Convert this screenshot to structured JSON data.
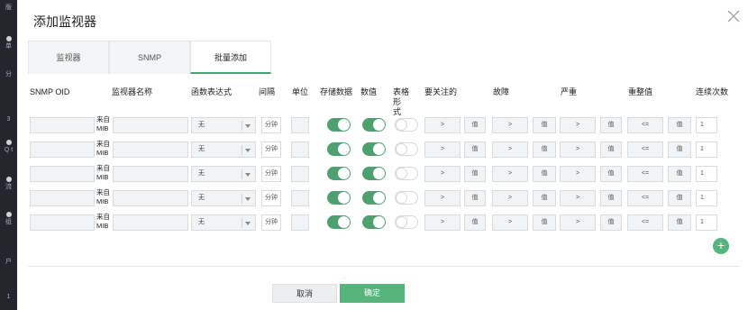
{
  "sidebar": {
    "fragments": [
      "版",
      "单",
      "分",
      "3",
      "Q\nt",
      "流",
      "组",
      "户",
      "1"
    ]
  },
  "dialog": {
    "title": "添加监视器",
    "tabs": [
      "监视器",
      "SNMP",
      "批量添加"
    ],
    "active_tab": "批量添加",
    "columns": {
      "snmp_oid": "SNMP OID",
      "monitor_name": "监视器名称",
      "function_expr": "函数表达式",
      "interval": "间隔",
      "unit": "单位",
      "store_data": "存储数据",
      "numeric": "数值",
      "table_format": "表格形\n式",
      "attention": "要关注的",
      "fault": "故障",
      "severe": "严重",
      "clear_value": "重整值",
      "consecutive": "连续次数"
    },
    "rows": [
      {
        "mib_label": "来自\nMIB",
        "function": "无",
        "interval_placeholder": "分钟",
        "store": true,
        "numeric": true,
        "table": false,
        "att_op": ">",
        "att_val": "值",
        "fault_op": ">",
        "fault_val": "值",
        "severe_op": ">",
        "severe_val": "值",
        "clear_op": "<=",
        "clear_val": "值",
        "count": "1"
      },
      {
        "mib_label": "来自\nMIB",
        "function": "无",
        "interval_placeholder": "分钟",
        "store": true,
        "numeric": true,
        "table": false,
        "att_op": ">",
        "att_val": "值",
        "fault_op": ">",
        "fault_val": "值",
        "severe_op": ">",
        "severe_val": "值",
        "clear_op": "<=",
        "clear_val": "值",
        "count": "1"
      },
      {
        "mib_label": "来自\nMIB",
        "function": "无",
        "interval_placeholder": "分钟",
        "store": true,
        "numeric": true,
        "table": false,
        "att_op": ">",
        "att_val": "值",
        "fault_op": ">",
        "fault_val": "值",
        "severe_op": ">",
        "severe_val": "值",
        "clear_op": "<=",
        "clear_val": "值",
        "count": "1"
      },
      {
        "mib_label": "来自\nMIB",
        "function": "无",
        "interval_placeholder": "分钟",
        "store": true,
        "numeric": true,
        "table": false,
        "att_op": ">",
        "att_val": "值",
        "fault_op": ">",
        "fault_val": "值",
        "severe_op": ">",
        "severe_val": "值",
        "clear_op": "<=",
        "clear_val": "值",
        "count": "1"
      },
      {
        "mib_label": "来自\nMIB",
        "function": "无",
        "interval_placeholder": "分钟",
        "store": true,
        "numeric": true,
        "table": false,
        "att_op": ">",
        "att_val": "值",
        "fault_op": ">",
        "fault_val": "值",
        "severe_op": ">",
        "severe_val": "值",
        "clear_op": "<=",
        "clear_val": "值",
        "count": "1"
      }
    ],
    "add_row_label": "+",
    "cancel_label": "取消",
    "ok_label": "确定",
    "accent_color": "#55b57b"
  }
}
